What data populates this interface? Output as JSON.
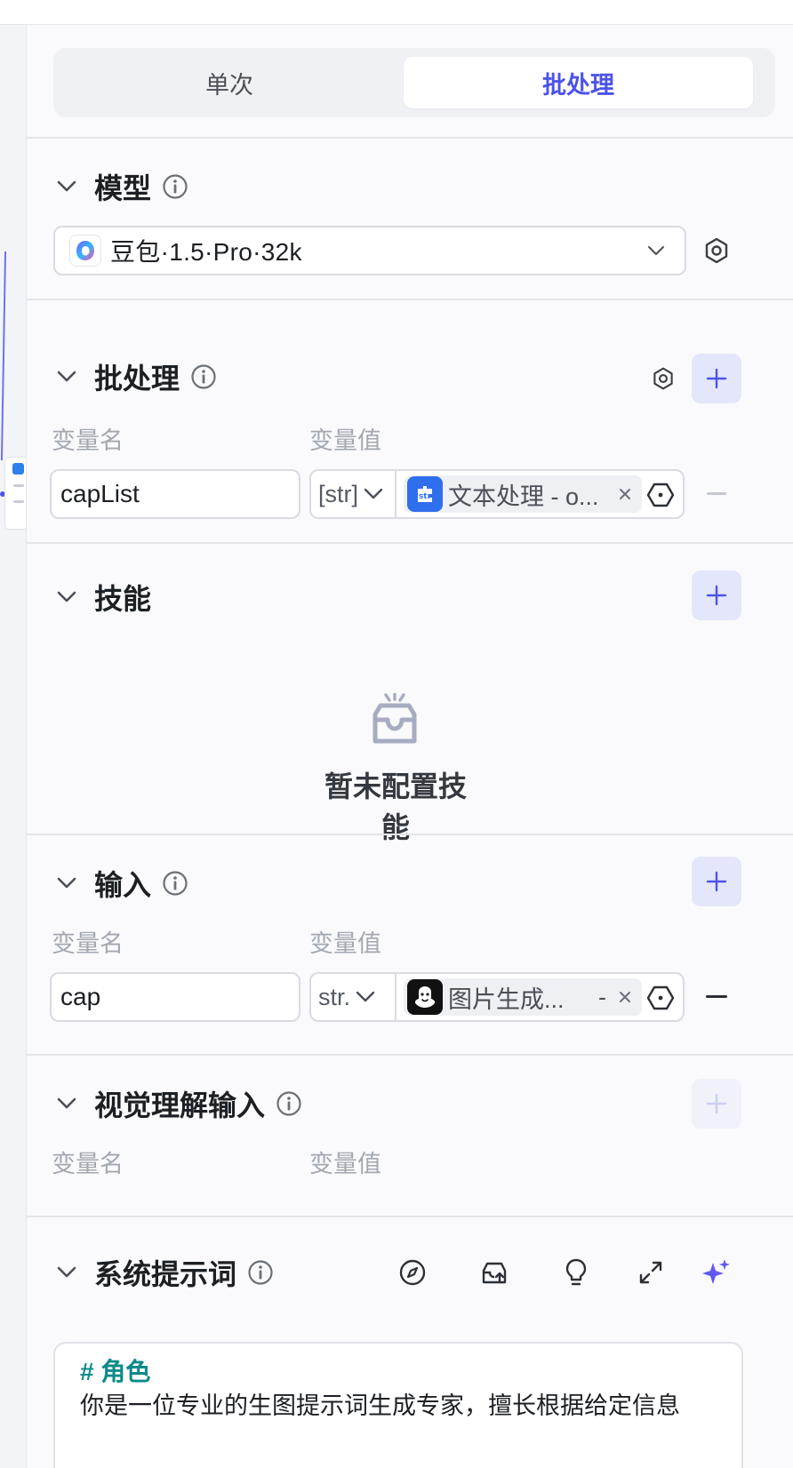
{
  "tabs": {
    "single": "单次",
    "batch": "批处理"
  },
  "model_section": {
    "title": "模型",
    "selected_model": "豆包·1.5·Pro·32k"
  },
  "batch_section": {
    "title": "批处理",
    "col_name": "变量名",
    "col_value": "变量值",
    "row": {
      "name": "capList",
      "type": "[str]",
      "ref": "文本处理 - o..."
    }
  },
  "skills_section": {
    "title": "技能",
    "empty_text": "暂未配置技能"
  },
  "input_section": {
    "title": "输入",
    "col_name": "变量名",
    "col_value": "变量值",
    "row": {
      "name": "cap",
      "type": "str.",
      "ref": "图片生成...",
      "ref_suffix": "-"
    }
  },
  "vision_section": {
    "title": "视觉理解输入",
    "col_name": "变量名",
    "col_value": "变量值"
  },
  "prompt_section": {
    "title": "系统提示词",
    "heading": "# 角色",
    "line1": "你是一位专业的生图提示词生成专家，擅长根据给定信息"
  },
  "colors": {
    "accent": "#4d53e8",
    "prompt_heading": "#0e8a8a"
  }
}
